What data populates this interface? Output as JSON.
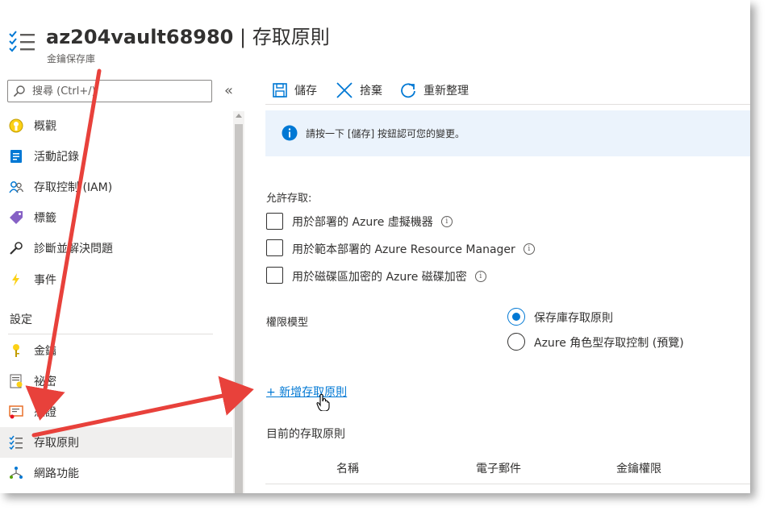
{
  "header": {
    "resource_name": "az204vault68980",
    "separator": "|",
    "page_name": "存取原則",
    "subtitle": "金鑰保存庫"
  },
  "sidebar": {
    "search_placeholder": "搜尋 (Ctrl+/)",
    "collapse_glyph": "«",
    "items": [
      {
        "label": "概觀",
        "icon": "overview-icon"
      },
      {
        "label": "活動記錄",
        "icon": "activity-log-icon"
      },
      {
        "label": "存取控制 (IAM)",
        "icon": "iam-icon"
      },
      {
        "label": "標籤",
        "icon": "tag-icon"
      },
      {
        "label": "診斷並解決問題",
        "icon": "wrench-icon"
      },
      {
        "label": "事件",
        "icon": "lightning-icon"
      }
    ],
    "section": "設定",
    "settings_items": [
      {
        "label": "金鑰",
        "icon": "key-icon"
      },
      {
        "label": "祕密",
        "icon": "secret-icon"
      },
      {
        "label": "憑證",
        "icon": "certificate-icon"
      },
      {
        "label": "存取原則",
        "icon": "access-policy-icon",
        "active": true
      },
      {
        "label": "網路功能",
        "icon": "networking-icon"
      }
    ]
  },
  "toolbar": {
    "save_label": "儲存",
    "discard_label": "捨棄",
    "refresh_label": "重新整理"
  },
  "banner": {
    "text": "請按一下 [儲存] 按鈕認可您的變更。"
  },
  "access": {
    "label": "允許存取:",
    "options": [
      {
        "label": "用於部署的 Azure 虛擬機器",
        "checked": false
      },
      {
        "label": "用於範本部署的 Azure Resource Manager",
        "checked": false
      },
      {
        "label": "用於磁碟區加密的 Azure 磁碟加密",
        "checked": false
      }
    ],
    "info_glyph": "i"
  },
  "permission_model": {
    "label": "權限模型",
    "options": [
      {
        "label": "保存庫存取原則",
        "selected": true
      },
      {
        "label": "Azure 角色型存取控制 (預覽)",
        "selected": false
      }
    ]
  },
  "add_policy_link": "+ 新增存取原則",
  "current_policies": {
    "label": "目前的存取原則",
    "columns": [
      "名稱",
      "電子郵件",
      "金鑰權限"
    ]
  },
  "colors": {
    "accent": "#0078d4",
    "annotation_arrow": "#e8413b",
    "banner_bg": "#ebf3fc",
    "active_nav_bg": "#f0efee"
  }
}
